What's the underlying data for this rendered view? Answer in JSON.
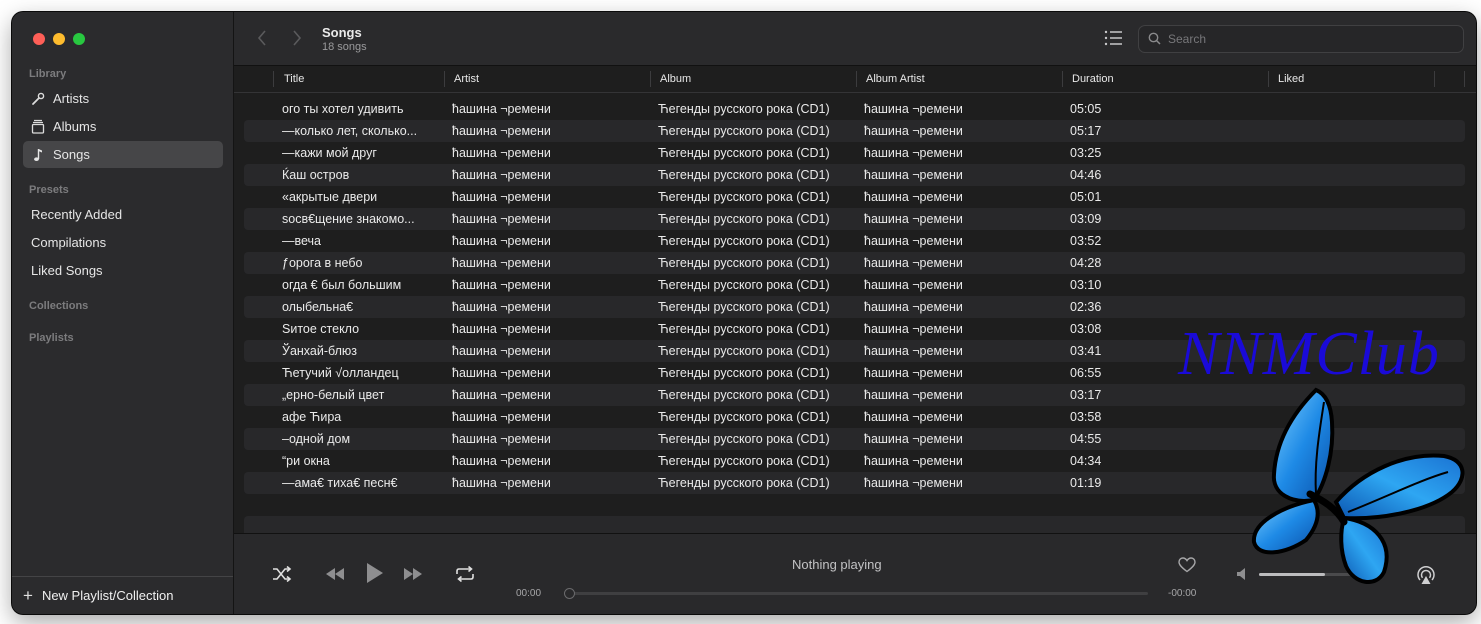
{
  "sidebar": {
    "sections": [
      {
        "label": "Library"
      },
      {
        "label": "Presets"
      },
      {
        "label": "Collections"
      },
      {
        "label": "Playlists"
      }
    ],
    "library_items": [
      {
        "label": "Artists",
        "icon": "microphone-icon"
      },
      {
        "label": "Albums",
        "icon": "albums-icon"
      },
      {
        "label": "Songs",
        "icon": "music-note-icon",
        "active": true
      }
    ],
    "preset_items": [
      {
        "label": "Recently Added"
      },
      {
        "label": "Compilations"
      },
      {
        "label": "Liked Songs"
      }
    ],
    "new_playlist_label": "New Playlist/Collection"
  },
  "toolbar": {
    "title": "Songs",
    "subtitle": "18 songs",
    "search_placeholder": "Search"
  },
  "table": {
    "columns": [
      "Title",
      "Artist",
      "Album",
      "Album Artist",
      "Duration",
      "Liked"
    ],
    "rows": [
      [
        "ого ты хотел удивить",
        "ћашина ¬ремени",
        "Ћегенды русского рока (CD1)",
        "ћашина ¬ремени",
        "05:05",
        ""
      ],
      [
        "—колько лет, сколько...",
        "ћашина ¬ремени",
        "Ћегенды русского рока (CD1)",
        "ћашина ¬ремени",
        "05:17",
        ""
      ],
      [
        "—кажи мой друг",
        "ћашина ¬ремени",
        "Ћегенды русского рока (CD1)",
        "ћашина ¬ремени",
        "03:25",
        ""
      ],
      [
        "Ќаш остров",
        "ћашина ¬ремени",
        "Ћегенды русского рока (CD1)",
        "ћашина ¬ремени",
        "04:46",
        ""
      ],
      [
        "«акрытые двери",
        "ћашина ¬ремени",
        "Ћегенды русского рока (CD1)",
        "ћашина ¬ремени",
        "05:01",
        ""
      ],
      [
        "sосв€щение знакомо...",
        "ћашина ¬ремени",
        "Ћегенды русского рока (CD1)",
        "ћашина ¬ремени",
        "03:09",
        ""
      ],
      [
        "—веча",
        "ћашина ¬ремени",
        "Ћегенды русского рока (CD1)",
        "ћашина ¬ремени",
        "03:52",
        ""
      ],
      [
        "ƒорога в небо",
        "ћашина ¬ремени",
        "Ћегенды русского рока (CD1)",
        "ћашина ¬ремени",
        "04:28",
        ""
      ],
      [
        "огда € был большим",
        "ћашина ¬ремени",
        "Ћегенды русского рока (CD1)",
        "ћашина ¬ремени",
        "03:10",
        ""
      ],
      [
        "олыбельна€",
        "ћашина ¬ремени",
        "Ћегенды русского рока (CD1)",
        "ћашина ¬ремени",
        "02:36",
        ""
      ],
      [
        "Sитое стекло",
        "ћашина ¬ремени",
        "Ћегенды русского рока (CD1)",
        "ћашина ¬ремени",
        "03:08",
        ""
      ],
      [
        "Ўанхай-блюз",
        "ћашина ¬ремени",
        "Ћегенды русского рока (CD1)",
        "ћашина ¬ремени",
        "03:41",
        ""
      ],
      [
        "Ћетучий √олландец",
        "ћашина ¬ремени",
        "Ћегенды русского рока (CD1)",
        "ћашина ¬ремени",
        "06:55",
        ""
      ],
      [
        "„ерно-белый цвет",
        "ћашина ¬ремени",
        "Ћегенды русского рока (CD1)",
        "ћашина ¬ремени",
        "03:17",
        ""
      ],
      [
        "афе Ћира",
        "ћашина ¬ремени",
        "Ћегенды русского рока (CD1)",
        "ћашина ¬ремени",
        "03:58",
        ""
      ],
      [
        "–одной дом",
        "ћашина ¬ремени",
        "Ћегенды русского рока (CD1)",
        "ћашина ¬ремени",
        "04:55",
        ""
      ],
      [
        "“ри окна",
        "ћашина ¬ремени",
        "Ћегенды русского рока (CD1)",
        "ћашина ¬ремени",
        "04:34",
        ""
      ],
      [
        "—ама€ тиха€ песн€",
        "ћашина ¬ремени",
        "Ћегенды русского рока (CD1)",
        "ћашина ¬ремени",
        "01:19",
        ""
      ]
    ]
  },
  "player": {
    "now_playing": "Nothing playing",
    "elapsed": "00:00",
    "remaining": "-00:00",
    "volume": 0.55
  },
  "watermark": {
    "text": "NNMClub"
  },
  "colors": {
    "window_bg": "#1e1e1e",
    "sidebar_bg": "#2b2b2d",
    "accent_traffic_red": "#fe5f57",
    "accent_traffic_yellow": "#febc2e",
    "accent_traffic_green": "#28c840",
    "watermark_blue": "#1a0ad8",
    "butterfly_blue": "#1e8ae6"
  }
}
